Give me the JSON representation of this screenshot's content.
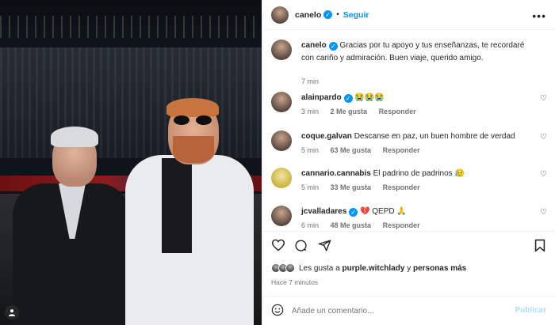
{
  "header": {
    "username": "canelo",
    "follow_label": "Seguir",
    "separator": "•",
    "more_label": "•••"
  },
  "caption": {
    "username": "canelo",
    "text": "Gracias por tu apoyo y tus enseñanzas, te recordaré con cariño y admiración. Buen viaje, querido amigo.",
    "time": "7 min"
  },
  "comments": [
    {
      "username": "alainpardo",
      "verified": true,
      "text": "😭😭😭",
      "time": "3 min",
      "likes": "2 Me gusta",
      "reply": "Responder"
    },
    {
      "username": "coque.galvan",
      "verified": false,
      "text": "Descanse en paz, un buen hombre de verdad",
      "time": "5 min",
      "likes": "63 Me gusta",
      "reply": "Responder"
    },
    {
      "username": "cannario.cannabis",
      "verified": false,
      "text": "El padrino de padrinos 😥",
      "time": "5 min",
      "likes": "33 Me gusta",
      "reply": "Responder"
    },
    {
      "username": "jcvalladares",
      "verified": true,
      "text": "💔 QEPD 🙏",
      "time": "6 min",
      "likes": "48 Me gusta",
      "reply": "Responder"
    }
  ],
  "likes": {
    "prefix": "Les gusta a",
    "user": "purple.witchlady",
    "connector": "y",
    "others": "personas más"
  },
  "posted_ago": "Hace 7 minutos",
  "comment_box": {
    "placeholder": "Añade un comentario...",
    "publish_label": "Publicar"
  },
  "colors": {
    "accent": "#0095f6",
    "text": "#262626",
    "muted": "#737373",
    "publish_disabled": "#b3dbff"
  },
  "icons": {
    "like": "heart-icon",
    "comment": "comment-icon",
    "share": "send-icon",
    "save": "bookmark-icon",
    "emoji": "smiley-icon",
    "tag": "user-tag-icon"
  }
}
